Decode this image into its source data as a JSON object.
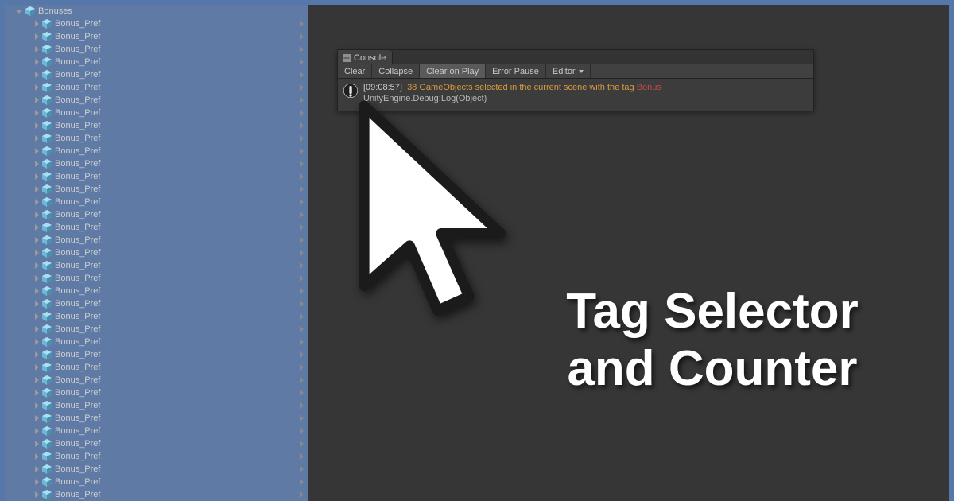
{
  "hierarchy": {
    "root_label": "Bonuses",
    "child_label": "Bonus_Pref",
    "child_count": 38
  },
  "console": {
    "tab_label": "Console",
    "toolbar": {
      "clear": "Clear",
      "collapse": "Collapse",
      "clear_on_play": "Clear on Play",
      "error_pause": "Error Pause",
      "editor": "Editor"
    },
    "log": {
      "timestamp": "[09:08:57]",
      "count": "38",
      "message_mid": " GameObjects selected in the current scene with the tag ",
      "tag": "Bonus",
      "source": "UnityEngine.Debug:Log(Object)"
    }
  },
  "headline": {
    "line1": "Tag Selector",
    "line2": "and Counter"
  }
}
